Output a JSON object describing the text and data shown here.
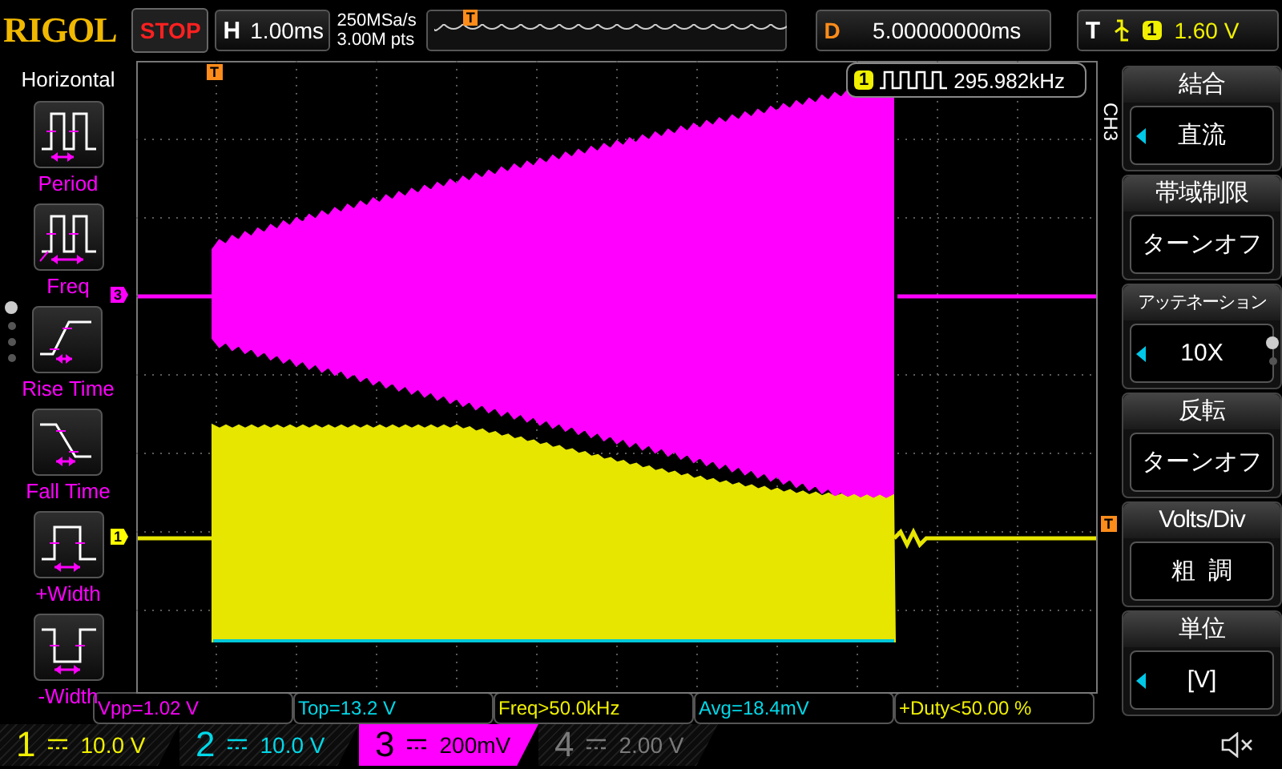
{
  "header": {
    "brand": "RIGOL",
    "run_state": "STOP",
    "timebase": {
      "label": "H",
      "value": "1.00ms"
    },
    "sample_rate": "250MSa/s",
    "memory_depth": "3.00M pts",
    "overview_marker": "T",
    "delay": {
      "label": "D",
      "value": "5.00000000ms"
    },
    "trigger": {
      "label": "T",
      "channel": "1",
      "level": "1.60 V"
    }
  },
  "left_menu": {
    "title": "Horizontal",
    "page_dots": [
      {
        "selected": true
      },
      {
        "selected": false
      },
      {
        "selected": false
      },
      {
        "selected": false
      }
    ],
    "items": [
      {
        "label": "Period",
        "kind": "period"
      },
      {
        "label": "Freq",
        "kind": "freq"
      },
      {
        "label": "Rise Time",
        "kind": "rise"
      },
      {
        "label": "Fall Time",
        "kind": "fall"
      },
      {
        "label": "+Width",
        "kind": "pwidth"
      },
      {
        "label": "-Width",
        "kind": "nwidth"
      }
    ]
  },
  "screen": {
    "trigger_marker": "T",
    "freq_counter": {
      "channel": "1",
      "value": "295.982kHz"
    },
    "trigger_level_marker": "T",
    "channel_markers": [
      {
        "label": "3",
        "color": "#ff00ff"
      },
      {
        "label": "1",
        "color": "#ffff00"
      }
    ]
  },
  "right_menu": {
    "channel_label": "CH3",
    "page_dots": [
      {
        "selected": true
      },
      {
        "selected": false
      }
    ],
    "items": [
      {
        "title": "結合",
        "value": "直流",
        "arrow": true
      },
      {
        "title": "帯域制限",
        "value": "ターンオフ",
        "arrow": false
      },
      {
        "title": "アッテネーション",
        "value": "10X",
        "arrow": true
      },
      {
        "title": "反転",
        "value": "ターンオフ",
        "arrow": false
      },
      {
        "title": "Volts/Div",
        "value": "粗  調",
        "arrow": false
      },
      {
        "title": "単位",
        "value": "[V]",
        "arrow": true
      }
    ]
  },
  "measurements": [
    {
      "text": "Vpp=1.02 V",
      "color": "#ff00ff"
    },
    {
      "text": "Top=13.2 V",
      "color": "#00d8e8"
    },
    {
      "text": "Freq>50.0kHz",
      "color": "#f0f000"
    },
    {
      "text": "Avg=18.4mV",
      "color": "#00d8e8"
    },
    {
      "text": "+Duty<50.00 %",
      "color": "#f0f000"
    }
  ],
  "channels": [
    {
      "number": "1",
      "value": "10.0 V",
      "color": "#f0f000",
      "selected": false
    },
    {
      "number": "2",
      "value": "10.0 V",
      "color": "#00d8e8",
      "selected": false
    },
    {
      "number": "3",
      "value": "200mV",
      "color": "#ff00ff",
      "selected": true
    },
    {
      "number": "4",
      "value": "2.00 V",
      "color": "#7a7a7a",
      "selected": false
    }
  ]
}
